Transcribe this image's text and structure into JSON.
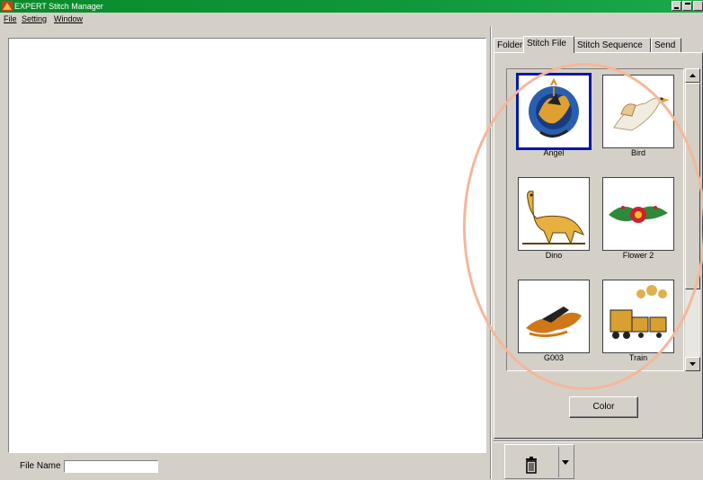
{
  "window": {
    "title": "EXPERT Stitch Manager"
  },
  "menu": {
    "items": [
      "File",
      "Setting",
      "Window"
    ]
  },
  "left": {
    "file_name_label": "File Name",
    "file_name_value": ""
  },
  "tabs": [
    {
      "label": "Folder",
      "active": false
    },
    {
      "label": "Stitch File",
      "active": true
    },
    {
      "label": "Stitch Sequence",
      "active": false
    },
    {
      "label": "Send",
      "active": false
    }
  ],
  "thumbnails": [
    {
      "label": "Angel",
      "selected": true,
      "icon": "angel-embroidery"
    },
    {
      "label": "Bird",
      "selected": false,
      "icon": "bird-embroidery"
    },
    {
      "label": "Dino",
      "selected": false,
      "icon": "dinosaur-embroidery"
    },
    {
      "label": "Flower 2",
      "selected": false,
      "icon": "flower-embroidery"
    },
    {
      "label": "G003",
      "selected": false,
      "icon": "plane-embroidery"
    },
    {
      "label": "Train",
      "selected": false,
      "icon": "train-embroidery"
    }
  ],
  "buttons": {
    "color": "Color"
  },
  "colors": {
    "title_bar": "#0e9a3a",
    "selection": "#0018a8",
    "highlight_ring": "#f5b79a"
  }
}
